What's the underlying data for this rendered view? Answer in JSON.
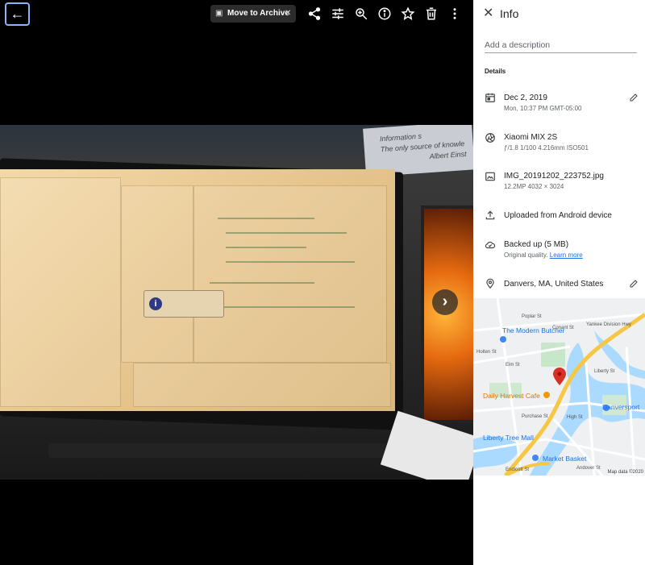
{
  "toolbar": {
    "back_icon": "arrow-left-icon",
    "archive_chip": {
      "label": "Move to Archive",
      "icon": "archive-icon",
      "close_icon": "close-icon"
    },
    "actions": [
      "share-icon",
      "adjust-icon",
      "zoom-in-icon",
      "info-icon",
      "star-icon",
      "delete-icon",
      "more-vert-icon"
    ]
  },
  "photo": {
    "sign_text": [
      "Information s",
      "The only source of knowle",
      "Albert Einst"
    ],
    "next_icon": "chevron-right-icon"
  },
  "info_panel": {
    "title": "Info",
    "description_placeholder": "Add a description",
    "details_heading": "Details",
    "date": {
      "main": "Dec 2, 2019",
      "sub": "Mon, 10:37 PM   GMT-05:00"
    },
    "camera": {
      "main": "Xiaomi MIX 2S",
      "sub": "ƒ/1.8    1/100    4.216mm    ISO501"
    },
    "file": {
      "main": "IMG_20191202_223752.jpg",
      "sub": "12.2MP    4032 × 3024"
    },
    "upload": {
      "main": "Uploaded from Android device"
    },
    "backup": {
      "main": "Backed up (5 MB)",
      "sub": "Original quality.",
      "link": "Learn more"
    },
    "location": {
      "main": "Danvers, MA, United States"
    },
    "map": {
      "labels": {
        "butcher": "The Modern Butcher",
        "cafe": "Daily Harvest Cafe",
        "danversport": "Danversport",
        "liberty": "Liberty Tree Mall",
        "market": "Market Basket",
        "poplar": "Poplar St",
        "conant": "Conant St",
        "elm": "Elm St",
        "holten": "Holten St",
        "purchase": "Purchase St",
        "high": "High St",
        "liberty_st": "Liberty St",
        "andover": "Andover St",
        "endicott": "Endicott St",
        "yankee": "Yankee Division Hwy"
      },
      "attribution": "Map data ©2020"
    },
    "colors": {
      "accent": "#1a73e8",
      "pin": "#d93025",
      "highway": "#f6c744"
    }
  }
}
